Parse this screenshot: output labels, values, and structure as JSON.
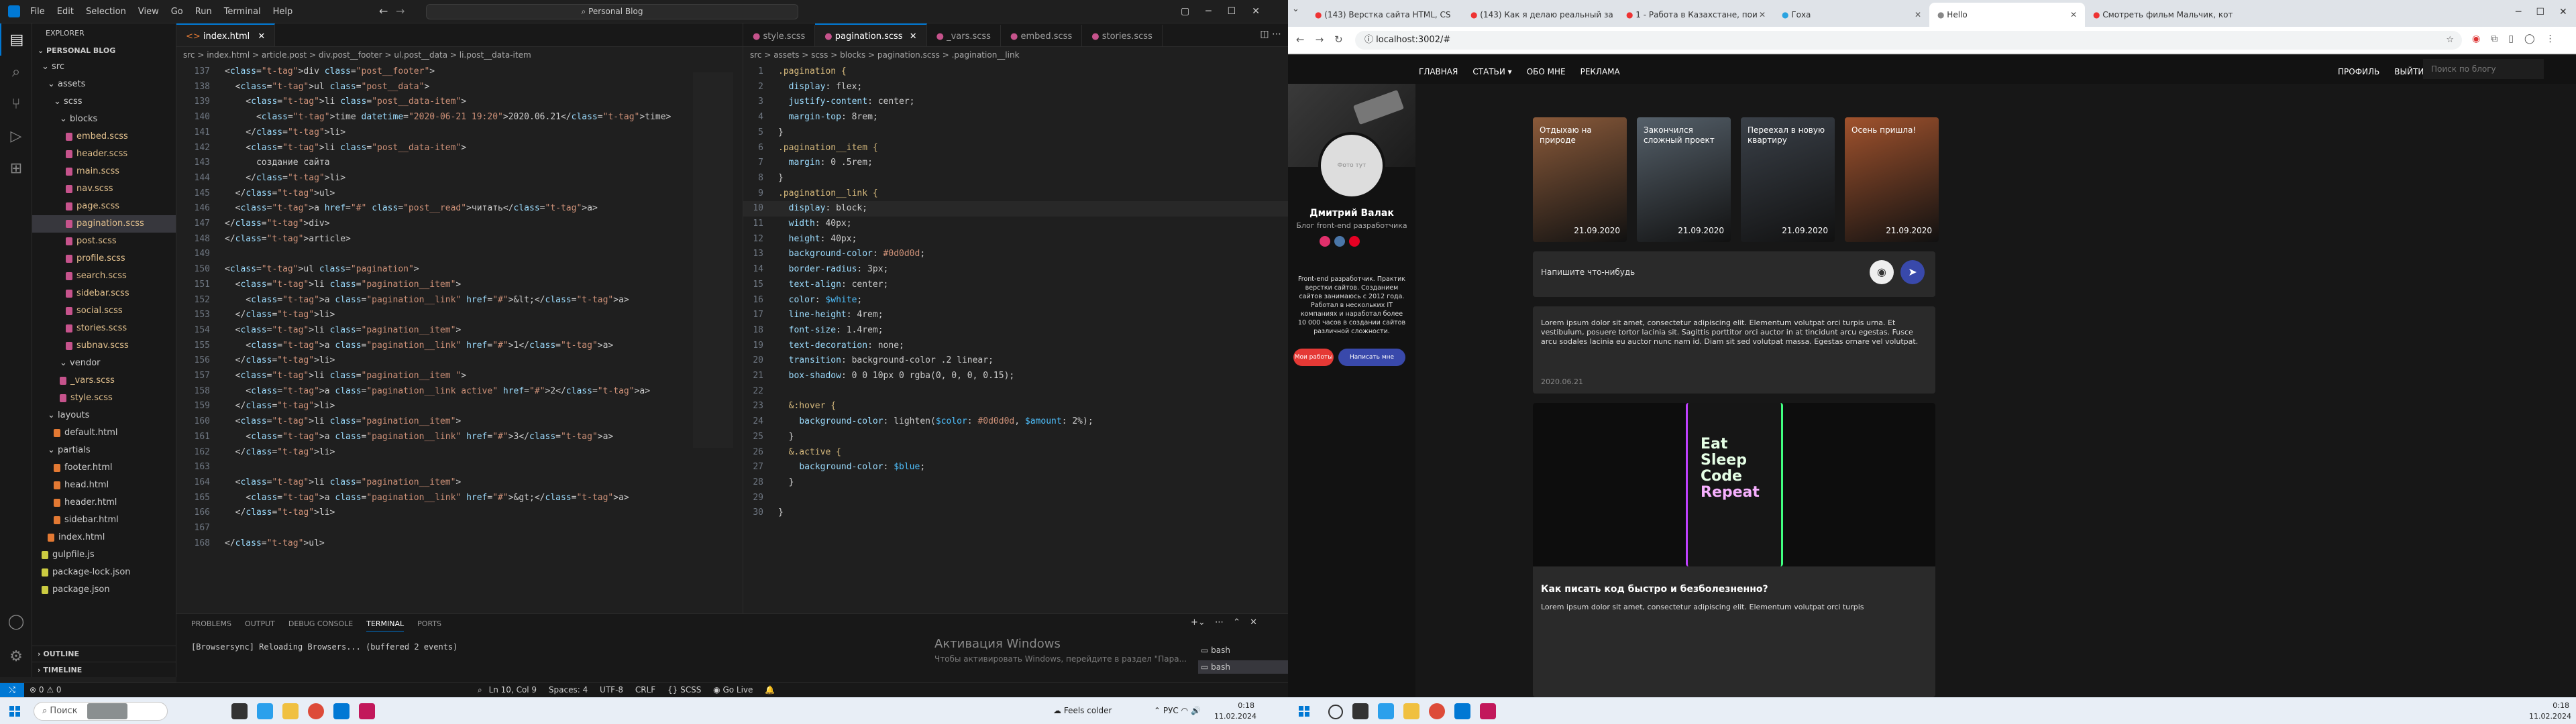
{
  "vscode": {
    "menu": [
      "File",
      "Edit",
      "Selection",
      "View",
      "Go",
      "Run",
      "Terminal",
      "Help"
    ],
    "search": "Personal Blog",
    "explorer_title": "EXPLORER",
    "project": "PERSONAL BLOG",
    "tree": [
      {
        "label": "src",
        "depth": 0,
        "kind": "folder"
      },
      {
        "label": "assets",
        "depth": 1,
        "kind": "folder"
      },
      {
        "label": "scss",
        "depth": 2,
        "kind": "folder"
      },
      {
        "label": "blocks",
        "depth": 3,
        "kind": "folder"
      },
      {
        "label": "embed.scss",
        "depth": 4,
        "kind": "scss"
      },
      {
        "label": "header.scss",
        "depth": 4,
        "kind": "scss"
      },
      {
        "label": "main.scss",
        "depth": 4,
        "kind": "scss"
      },
      {
        "label": "nav.scss",
        "depth": 4,
        "kind": "scss"
      },
      {
        "label": "page.scss",
        "depth": 4,
        "kind": "scss"
      },
      {
        "label": "pagination.scss",
        "depth": 4,
        "kind": "scss",
        "selected": true
      },
      {
        "label": "post.scss",
        "depth": 4,
        "kind": "scss"
      },
      {
        "label": "profile.scss",
        "depth": 4,
        "kind": "scss"
      },
      {
        "label": "search.scss",
        "depth": 4,
        "kind": "scss"
      },
      {
        "label": "sidebar.scss",
        "depth": 4,
        "kind": "scss"
      },
      {
        "label": "social.scss",
        "depth": 4,
        "kind": "scss"
      },
      {
        "label": "stories.scss",
        "depth": 4,
        "kind": "scss"
      },
      {
        "label": "subnav.scss",
        "depth": 4,
        "kind": "scss"
      },
      {
        "label": "vendor",
        "depth": 3,
        "kind": "folder"
      },
      {
        "label": "_vars.scss",
        "depth": 3,
        "kind": "scss"
      },
      {
        "label": "style.scss",
        "depth": 3,
        "kind": "scss"
      },
      {
        "label": "layouts",
        "depth": 1,
        "kind": "folder"
      },
      {
        "label": "default.html",
        "depth": 2,
        "kind": "html"
      },
      {
        "label": "partials",
        "depth": 1,
        "kind": "folder"
      },
      {
        "label": "footer.html",
        "depth": 2,
        "kind": "html"
      },
      {
        "label": "head.html",
        "depth": 2,
        "kind": "html"
      },
      {
        "label": "header.html",
        "depth": 2,
        "kind": "html"
      },
      {
        "label": "sidebar.html",
        "depth": 2,
        "kind": "html"
      },
      {
        "label": "index.html",
        "depth": 1,
        "kind": "html"
      },
      {
        "label": "gulpfile.js",
        "depth": 0,
        "kind": "js"
      },
      {
        "label": "package-lock.json",
        "depth": 0,
        "kind": "json"
      },
      {
        "label": "package.json",
        "depth": 0,
        "kind": "json"
      }
    ],
    "outline": "OUTLINE",
    "timeline": "TIMELINE",
    "left_tabs": [
      "index.html"
    ],
    "left_crumbs": "src > index.html > article.post > div.post__footer > ul.post__data > li.post__data-item",
    "right_tabs": [
      "style.scss",
      "pagination.scss",
      "_vars.scss",
      "embed.scss",
      "stories.scss"
    ],
    "right_crumbs": "src > assets > scss > blocks > pagination.scss > .pagination__link",
    "html_lines": [
      [
        "137",
        "<div class=\"post__footer\">"
      ],
      [
        "138",
        "  <ul class=\"post__data\">"
      ],
      [
        "139",
        "    <li class=\"post__data-item\">"
      ],
      [
        "140",
        "      <time datetime=\"2020-06-21 19:20\">2020.06.21</time>"
      ],
      [
        "141",
        "    </li>"
      ],
      [
        "142",
        "    <li class=\"post__data-item\">"
      ],
      [
        "143",
        "      создание сайта"
      ],
      [
        "144",
        "    </li>"
      ],
      [
        "145",
        "  </ul>"
      ],
      [
        "146",
        "  <a href=\"#\" class=\"post__read\">читать</a>"
      ],
      [
        "147",
        "</div>"
      ],
      [
        "148",
        "</article>"
      ],
      [
        "149",
        ""
      ],
      [
        "150",
        "<ul class=\"pagination\">"
      ],
      [
        "151",
        "  <li class=\"pagination__item\">"
      ],
      [
        "152",
        "    <a class=\"pagination__link\" href=\"#\">&lt;</a>"
      ],
      [
        "153",
        "  </li>"
      ],
      [
        "154",
        "  <li class=\"pagination__item\">"
      ],
      [
        "155",
        "    <a class=\"pagination__link\" href=\"#\">1</a>"
      ],
      [
        "156",
        "  </li>"
      ],
      [
        "157",
        "  <li class=\"pagination__item \">"
      ],
      [
        "158",
        "    <a class=\"pagination__link active\" href=\"#\">2</a>"
      ],
      [
        "159",
        "  </li>"
      ],
      [
        "160",
        "  <li class=\"pagination__item\">"
      ],
      [
        "161",
        "    <a class=\"pagination__link\" href=\"#\">3</a>"
      ],
      [
        "162",
        "  </li>"
      ],
      [
        "163",
        ""
      ],
      [
        "164",
        "  <li class=\"pagination__item\">"
      ],
      [
        "165",
        "    <a class=\"pagination__link\" href=\"#\">&gt;</a>"
      ],
      [
        "166",
        "  </li>"
      ],
      [
        "167",
        ""
      ],
      [
        "168",
        "</ul>"
      ]
    ],
    "scss_lines": [
      [
        "1",
        ".pagination {"
      ],
      [
        "2",
        "  display: flex;"
      ],
      [
        "3",
        "  justify-content: center;"
      ],
      [
        "4",
        "  margin-top: 8rem;"
      ],
      [
        "5",
        "}"
      ],
      [
        "6",
        ".pagination__item {"
      ],
      [
        "7",
        "  margin: 0 .5rem;"
      ],
      [
        "8",
        "}"
      ],
      [
        "9",
        ".pagination__link {"
      ],
      [
        "10",
        "  display: block;"
      ],
      [
        "11",
        "  width: 40px;"
      ],
      [
        "12",
        "  height: 40px;"
      ],
      [
        "13",
        "  background-color: #0d0d0d;"
      ],
      [
        "14",
        "  border-radius: 3px;"
      ],
      [
        "15",
        "  text-align: center;"
      ],
      [
        "16",
        "  color: $white;"
      ],
      [
        "17",
        "  line-height: 4rem;"
      ],
      [
        "18",
        "  font-size: 1.4rem;"
      ],
      [
        "19",
        "  text-decoration: none;"
      ],
      [
        "20",
        "  transition: background-color .2 linear;"
      ],
      [
        "21",
        "  box-shadow: 0 0 10px 0 rgba(0, 0, 0, 0.15);"
      ],
      [
        "22",
        ""
      ],
      [
        "23",
        "  &:hover {"
      ],
      [
        "24",
        "    background-color: lighten($color: #0d0d0d, $amount: 2%);"
      ],
      [
        "25",
        "  }"
      ],
      [
        "26",
        "  &.active {"
      ],
      [
        "27",
        "    background-color: $blue;"
      ],
      [
        "28",
        "  }"
      ],
      [
        "29",
        ""
      ],
      [
        "30",
        "}"
      ]
    ],
    "panel_tabs": [
      "PROBLEMS",
      "OUTPUT",
      "DEBUG CONSOLE",
      "TERMINAL",
      "PORTS"
    ],
    "terminal_text": "[Browsersync] Reloading Browsers... (buffered 2 events)",
    "terminal_sessions": [
      "bash",
      "bash"
    ],
    "activation_title": "Активация Windows",
    "activation_sub": "Чтобы активировать Windows, перейдите в раздел \"Пара...",
    "status": {
      "pos": "Ln 10, Col 9",
      "spaces": "Spaces: 4",
      "enc": "UTF-8",
      "eol": "CRLF",
      "lang": "SCSS",
      "golive": "Go Live",
      "errors": "0",
      "warnings": "0"
    }
  },
  "taskbar1": {
    "search": "Поиск",
    "weather": "Feels colder",
    "lang": "РУС",
    "time": "0:18",
    "date": "11.02.2024"
  },
  "browser": {
    "tabs": [
      "(143) Верстка сайта HTML, CS",
      "(143) Как я делаю реальный за",
      "1 - Работа в Казахстане, пои",
      "Гоха",
      "Hello",
      "Смотреть фильм Мальчик, кот"
    ],
    "active_tab": 4,
    "url": "localhost:3002/#",
    "nav": [
      "ГЛАВНАЯ",
      "СТАТЬИ",
      "ОБО МНЕ",
      "РЕКЛАМА"
    ],
    "nav_right": [
      "ПРОФИЛЬ",
      "ВЫЙТИ"
    ],
    "search_placeholder": "Поиск по блогу",
    "profile": {
      "name": "Дмитрий Валак",
      "subtitle": "Блог front-end разработчика",
      "avatar_text": "Фото тут",
      "about": "Front-end разработчик. Практик верстки сайтов. Созданием сайтов занимаюсь с 2012 года. Работал в нескольких IT компаниях и наработал более 10 000 часов в создании сайтов различной сложности.",
      "btn_works": "Мои работы",
      "btn_write": "Написать мне"
    },
    "stories": [
      {
        "title": "Отдыхаю на природе",
        "date": "21.09.2020",
        "color": "#8a5a3a"
      },
      {
        "title": "Закончился сложный проект",
        "date": "21.09.2020",
        "color": "#55606a"
      },
      {
        "title": "Переехал в новую квартиру",
        "date": "21.09.2020",
        "color": "#3a4048"
      },
      {
        "title": "Осень пришла!",
        "date": "21.09.2020",
        "color": "#a0522d"
      }
    ],
    "compose_placeholder": "Напишите что-нибудь",
    "post1": {
      "text": "Lorem ipsum dolor sit amet, consectetur adipiscing elit. Elementum volutpat orci turpis urna. Et vestibulum, posuere tortor lacinia sit. Sagittis porttitor orci auctor in at tincidunt arcu egestas. Fusce arcu sodales lacinia eu auctor nunc nam id. Diam sit sed volutpat massa. Egestas ornare vel volutpat.",
      "date": "2020.06.21"
    },
    "post2": {
      "image_words": [
        "Eat",
        "Sleep",
        "Code",
        "Repeat"
      ],
      "title": "Как писать код быстро и безболезненно?",
      "text": "Lorem ipsum dolor sit amet, consectetur adipiscing elit. Elementum volutpat orci turpis"
    }
  },
  "taskbar2": {
    "time": "0:18",
    "date": "11.02.2024"
  }
}
